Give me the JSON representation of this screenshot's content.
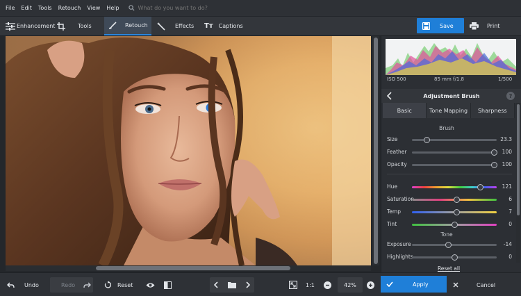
{
  "menu": [
    "File",
    "Edit",
    "Tools",
    "Retouch",
    "View",
    "Help"
  ],
  "search": {
    "placeholder": "What do you want to do?"
  },
  "toolbar": {
    "enhancement": "Enhancement",
    "tools": "Tools",
    "retouch": "Retouch",
    "effects": "Effects",
    "captions": "Captions",
    "save": "Save",
    "print": "Print",
    "active_tab": "Retouch"
  },
  "histogram": {
    "iso": "ISO 500",
    "lens": "85 mm f/1.8",
    "shutter": "1/500"
  },
  "panel": {
    "title": "Adjustment Brush",
    "tabs": [
      "Basic",
      "Tone Mapping",
      "Sharpness"
    ],
    "active_tab": "Basic",
    "brush_section": "Brush",
    "brush": [
      {
        "label": "Size",
        "value": "23.3",
        "position": 0.18
      },
      {
        "label": "Feather",
        "value": "100",
        "position": 0.97
      },
      {
        "label": "Opacity",
        "value": "100",
        "position": 0.97
      }
    ],
    "color": [
      {
        "label": "Hue",
        "value": "121",
        "position": 0.81
      },
      {
        "label": "Saturation",
        "value": "6",
        "position": 0.53
      },
      {
        "label": "Temp",
        "value": "7",
        "position": 0.53
      },
      {
        "label": "Tint",
        "value": "0",
        "position": 0.5
      }
    ],
    "tone_section": "Tone",
    "tone": [
      {
        "label": "Exposure",
        "value": "-14",
        "position": 0.43
      },
      {
        "label": "Highlights",
        "value": "0",
        "position": 0.5
      }
    ],
    "reset_all": "Reset all"
  },
  "bottombar": {
    "undo": "Undo",
    "redo": "Redo",
    "reset": "Reset",
    "zoom_1to1": "1:1",
    "zoom_level": "42%",
    "apply": "Apply",
    "cancel": "Cancel"
  },
  "colors": {
    "accent": "#1f7fd8",
    "bg": "#2b2e33"
  }
}
